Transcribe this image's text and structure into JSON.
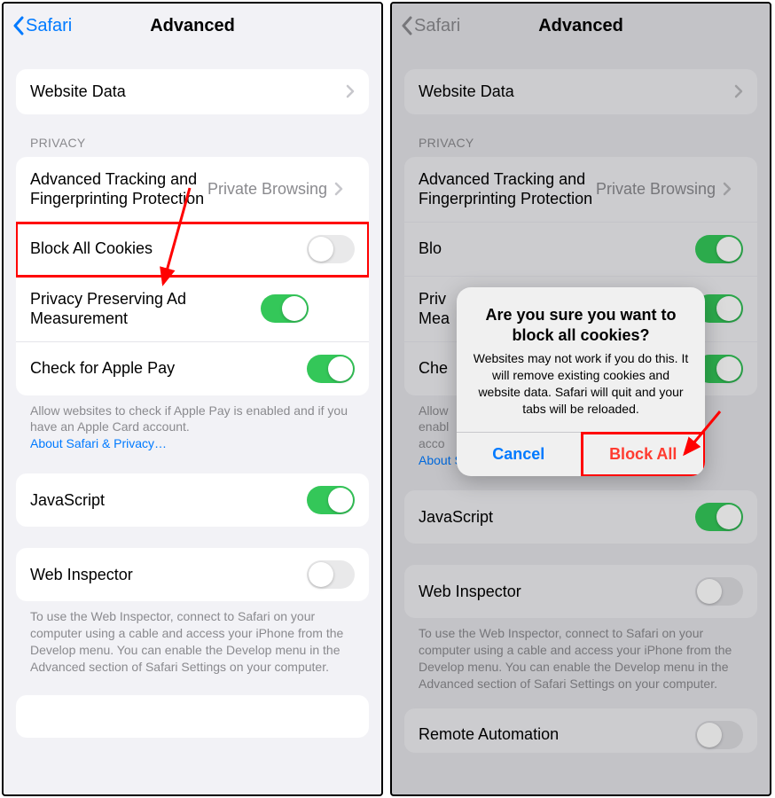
{
  "left": {
    "nav": {
      "back": "Safari",
      "title": "Advanced"
    },
    "websiteData": "Website Data",
    "privacyHeader": "PRIVACY",
    "atfp": {
      "label": "Advanced Tracking and Fingerprinting Protection",
      "value": "Private Browsing"
    },
    "blockCookies": "Block All Cookies",
    "ppam": "Privacy Preserving Ad Measurement",
    "applePay": "Check for Apple Pay",
    "applePayFooter": "Allow websites to check if Apple Pay is enabled and if you have an Apple Card account.",
    "privacyLink": "About Safari & Privacy…",
    "javascript": "JavaScript",
    "webInspector": "Web Inspector",
    "webInspectorFooter": "To use the Web Inspector, connect to Safari on your computer using a cable and access your iPhone from the Develop menu. You can enable the Develop menu in the Advanced section of Safari Settings on your computer."
  },
  "right": {
    "nav": {
      "back": "Safari",
      "title": "Advanced"
    },
    "websiteData": "Website Data",
    "privacyHeader": "PRIVACY",
    "atfp": {
      "label": "Advanced Tracking and Fingerprinting Protection",
      "value": "Private Browsing"
    },
    "blockCookiesShort": "Blo",
    "ppamShort1": "Priv",
    "ppamShort2": "Mea",
    "applePayShort": "Che",
    "applePayFooter1": "Allow",
    "applePayFooter2": "enabl",
    "applePayFooter3": "acco",
    "privacyLink": "About Safari & Privacy…",
    "javascript": "JavaScript",
    "webInspector": "Web Inspector",
    "webInspectorFooter": "To use the Web Inspector, connect to Safari on your computer using a cable and access your iPhone from the Develop menu. You can enable the Develop menu in the Advanced section of Safari Settings on your computer.",
    "remote": "Remote Automation",
    "dialog": {
      "title": "Are you sure you want to block all cookies?",
      "message": "Websites may not work if you do this. It will remove existing cookies and website data. Safari will quit and your tabs will be reloaded.",
      "cancel": "Cancel",
      "confirm": "Block All"
    }
  },
  "colors": {
    "accent": "#007aff",
    "green": "#34c759",
    "red": "#ff3b30",
    "highlight": "#ff0000"
  }
}
